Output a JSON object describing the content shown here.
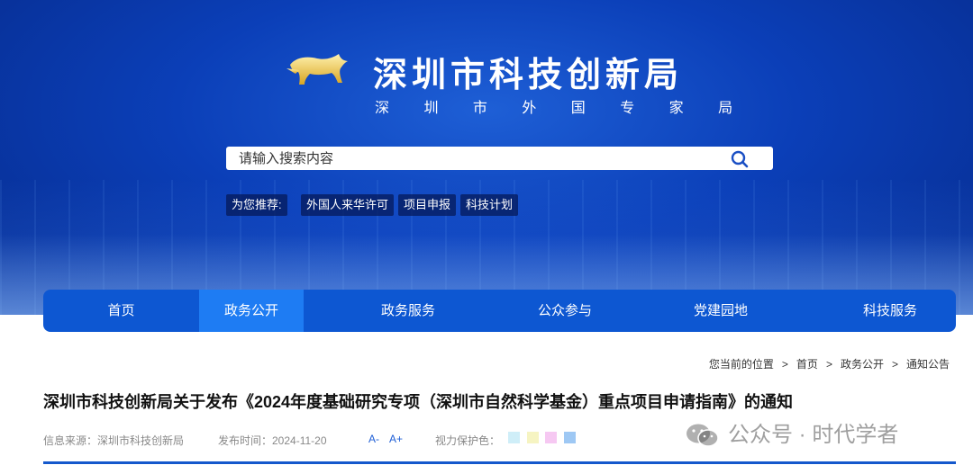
{
  "header": {
    "org_name": "深圳市科技创新局",
    "org_sub": "深 圳 市 外 国 专 家 局"
  },
  "search": {
    "placeholder": "请输入搜索内容"
  },
  "recommend": {
    "label": "为您推荐:",
    "tags": [
      "外国人来华许可",
      "项目申报",
      "科技计划"
    ]
  },
  "nav": {
    "items": [
      "首页",
      "政务公开",
      "政务服务",
      "公众参与",
      "党建园地",
      "科技服务"
    ],
    "active": "政务公开"
  },
  "breadcrumb": {
    "prefix": "您当前的位置",
    "items": [
      "首页",
      "政务公开",
      "通知公告"
    ]
  },
  "article": {
    "title": "深圳市科技创新局关于发布《2024年度基础研究专项（深圳市自然科学基金）重点项目申请指南》的通知",
    "source": "信息来源：深圳市科技创新局",
    "date": "发布时间：2024-11-20",
    "font_smaller": "A-",
    "font_larger": "A+",
    "eye_care_label": "视力保护色："
  },
  "eye_care_colors": [
    "#cfeef8",
    "#f6f4c2",
    "#f6c8f2",
    "#9ec8f4"
  ],
  "watermark": {
    "text": "公众号 · 时代学者"
  },
  "colors": {
    "brand": "#0d57d2",
    "nav_active": "#1e7cf3",
    "link": "#1e5ed6"
  }
}
